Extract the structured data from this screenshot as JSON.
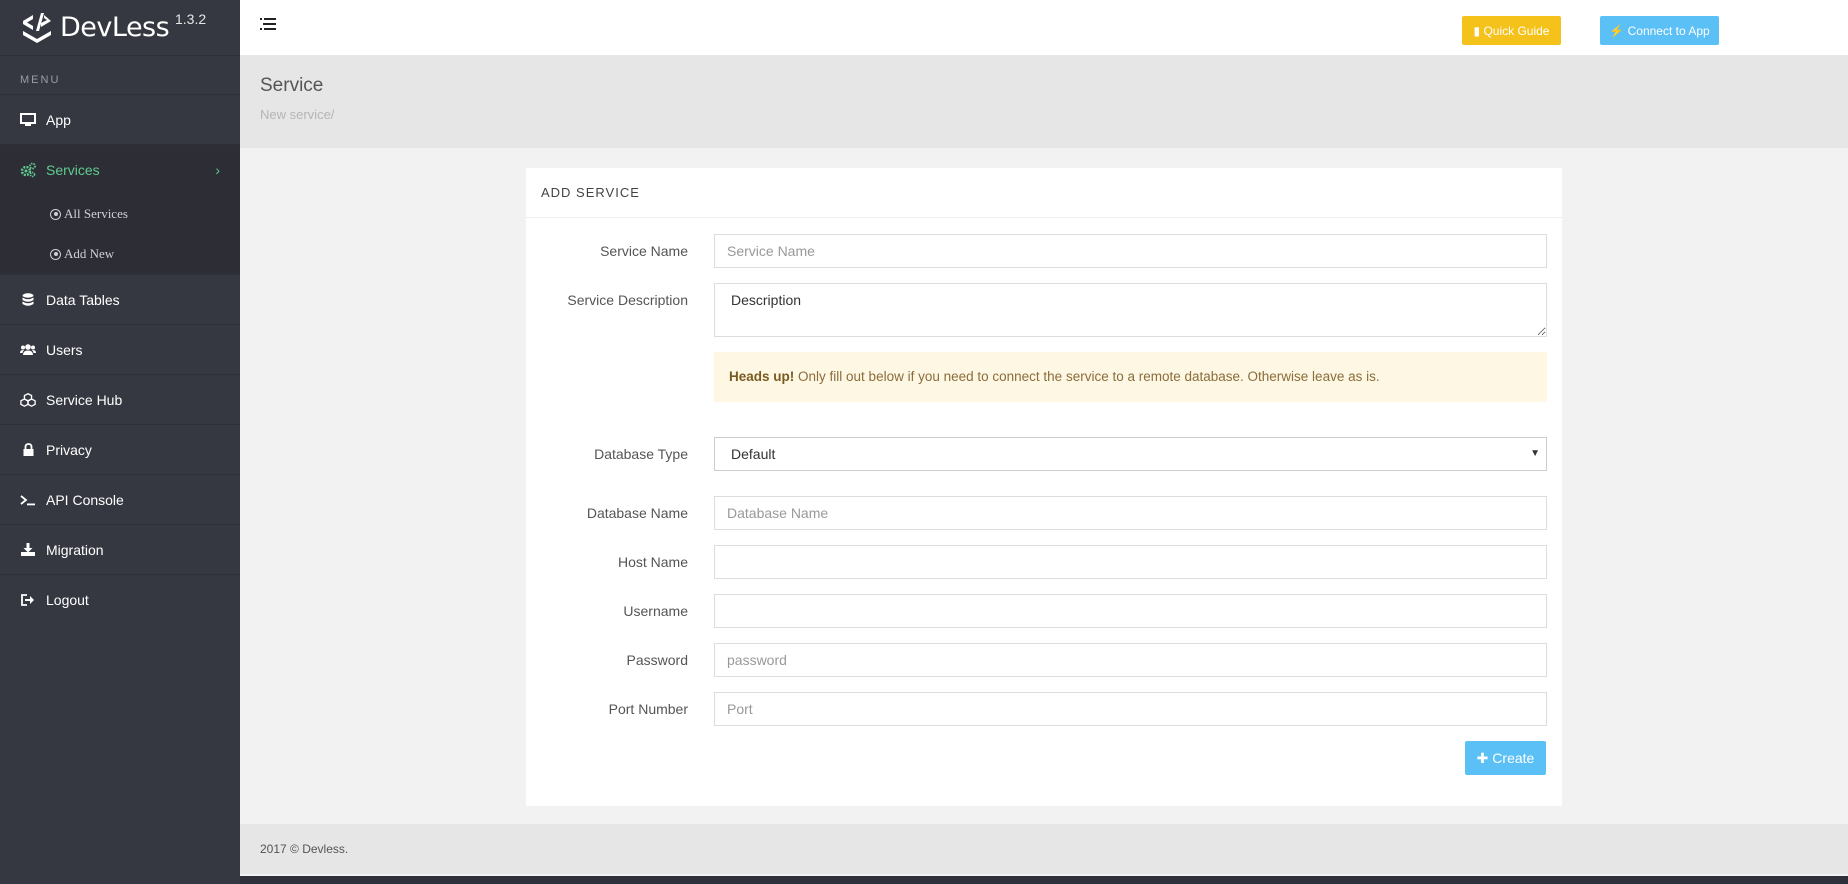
{
  "brand": {
    "name": "DevLess",
    "version": "1.3.2"
  },
  "sidebar": {
    "menu_label": "MENU",
    "items": [
      {
        "label": "App",
        "icon": "monitor-icon"
      },
      {
        "label": "Services",
        "icon": "cogs-icon",
        "active": true
      },
      {
        "label": "Data Tables",
        "icon": "database-icon"
      },
      {
        "label": "Users",
        "icon": "users-icon"
      },
      {
        "label": "Service Hub",
        "icon": "cubes-icon"
      },
      {
        "label": "Privacy",
        "icon": "lock-icon"
      },
      {
        "label": "API Console",
        "icon": "terminal-icon"
      },
      {
        "label": "Migration",
        "icon": "download-icon"
      },
      {
        "label": "Logout",
        "icon": "sign-out-icon"
      }
    ],
    "sub_items": [
      {
        "label": "All Services"
      },
      {
        "label": "Add New"
      }
    ]
  },
  "topbar": {
    "quick_guide_label": "Quick Guide",
    "connect_label": "Connect to App",
    "quick_guide_color": "#f5c21b",
    "connect_color": "#5bc0f5"
  },
  "page": {
    "title": "Service",
    "breadcrumb": "New service/"
  },
  "form": {
    "heading": "ADD SERVICE",
    "service_name": {
      "label": "Service Name",
      "placeholder": "Service Name",
      "value": ""
    },
    "service_description": {
      "label": "Service Description",
      "value": "Description"
    },
    "alert": {
      "strong": "Heads up!",
      "text": "Only fill out below if you need to connect the service to a remote database. Otherwise leave as is."
    },
    "database_type": {
      "label": "Database Type",
      "selected": "Default"
    },
    "database_name": {
      "label": "Database Name",
      "placeholder": "Database Name"
    },
    "host_name": {
      "label": "Host Name",
      "placeholder": ""
    },
    "username": {
      "label": "Username",
      "placeholder": ""
    },
    "password": {
      "label": "Password",
      "placeholder": "password"
    },
    "port_number": {
      "label": "Port Number",
      "placeholder": "Port"
    },
    "create_label": "Create"
  },
  "footer": {
    "text": "2017 © Devless."
  }
}
